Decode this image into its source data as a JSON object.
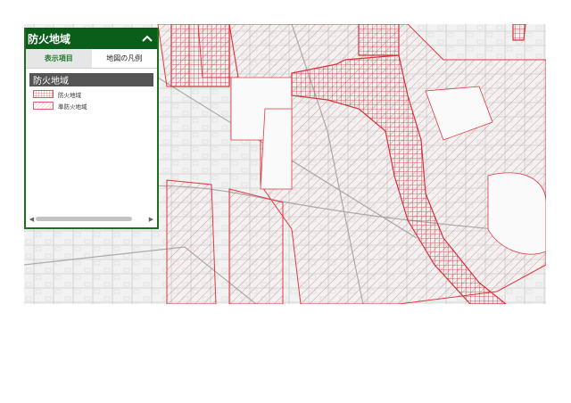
{
  "panel": {
    "title": "防火地域",
    "tabs": [
      {
        "label": "表示項目",
        "active": true
      },
      {
        "label": "地図の凡例",
        "active": false
      }
    ],
    "layer_name": "防火地域",
    "legend": [
      {
        "label": "防火地域",
        "pattern": "grid"
      },
      {
        "label": "準防火地域",
        "pattern": "diagonal"
      }
    ],
    "collapse_icon": "chevron-up-icon"
  },
  "colors": {
    "header_bg": "#0b5e1a",
    "zone_red": "#e0393e",
    "tab_active_text": "#1f7a2a"
  }
}
